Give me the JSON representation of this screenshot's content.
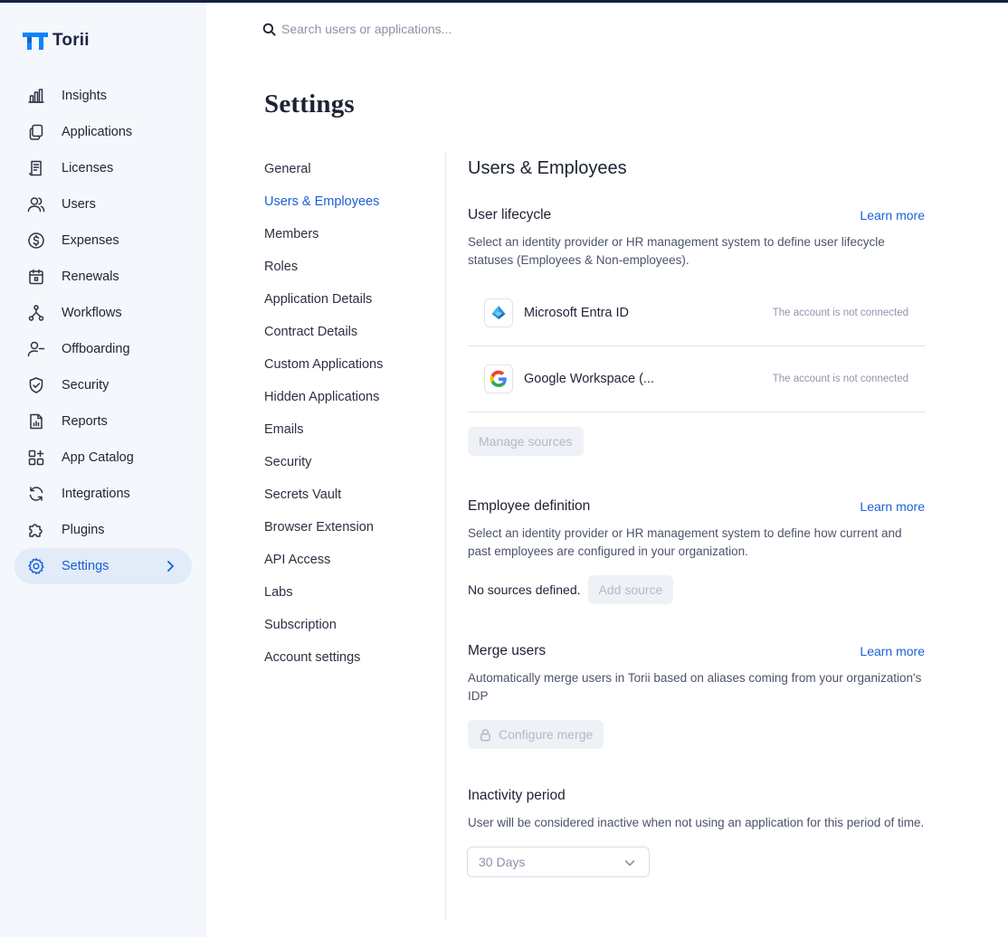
{
  "brand": {
    "name": "Torii",
    "accent": "#1a5fd6",
    "logo_color": "#0a84ff"
  },
  "search": {
    "placeholder": "Search users or applications..."
  },
  "sidebar": {
    "items": [
      {
        "label": "Insights",
        "icon": "bar-chart-icon"
      },
      {
        "label": "Applications",
        "icon": "copy-icon"
      },
      {
        "label": "Licenses",
        "icon": "receipt-icon"
      },
      {
        "label": "Users",
        "icon": "users-icon"
      },
      {
        "label": "Expenses",
        "icon": "dollar-circle-icon"
      },
      {
        "label": "Renewals",
        "icon": "calendar-icon"
      },
      {
        "label": "Workflows",
        "icon": "workflow-icon"
      },
      {
        "label": "Offboarding",
        "icon": "user-minus-icon"
      },
      {
        "label": "Security",
        "icon": "shield-check-icon"
      },
      {
        "label": "Reports",
        "icon": "report-icon"
      },
      {
        "label": "App Catalog",
        "icon": "grid-plus-icon"
      },
      {
        "label": "Integrations",
        "icon": "refresh-icon"
      },
      {
        "label": "Plugins",
        "icon": "puzzle-icon"
      },
      {
        "label": "Settings",
        "icon": "gear-icon",
        "active": true
      }
    ]
  },
  "page": {
    "title": "Settings"
  },
  "settings_nav": {
    "items": [
      "General",
      "Users & Employees",
      "Members",
      "Roles",
      "Application Details",
      "Contract Details",
      "Custom Applications",
      "Hidden Applications",
      "Emails",
      "Security",
      "Secrets Vault",
      "Browser Extension",
      "API Access",
      "Labs",
      "Subscription",
      "Account settings"
    ],
    "active": "Users & Employees"
  },
  "content": {
    "title": "Users & Employees",
    "user_lifecycle": {
      "title": "User lifecycle",
      "learn_more": "Learn more",
      "description": "Select an identity provider or HR management system to define user lifecycle statuses (Employees & Non-employees).",
      "sources": [
        {
          "name": "Microsoft Entra ID",
          "status": "The account is not connected",
          "icon": "microsoft-entra-icon"
        },
        {
          "name": "Google Workspace (...",
          "status": "The account is not connected",
          "icon": "google-icon"
        }
      ],
      "manage_button": "Manage sources"
    },
    "employee_definition": {
      "title": "Employee definition",
      "learn_more": "Learn more",
      "description": "Select an identity provider or HR management system to define how current and past employees are configured in your organization.",
      "no_sources": "No sources defined.",
      "add_button": "Add source"
    },
    "merge_users": {
      "title": "Merge users",
      "learn_more": "Learn more",
      "description": "Automatically merge users in Torii based on aliases coming from your organization's IDP",
      "configure_button": "Configure merge"
    },
    "inactivity": {
      "title": "Inactivity period",
      "description": "User will be considered inactive when not using an application for this period of time.",
      "selected": "30 Days"
    }
  }
}
